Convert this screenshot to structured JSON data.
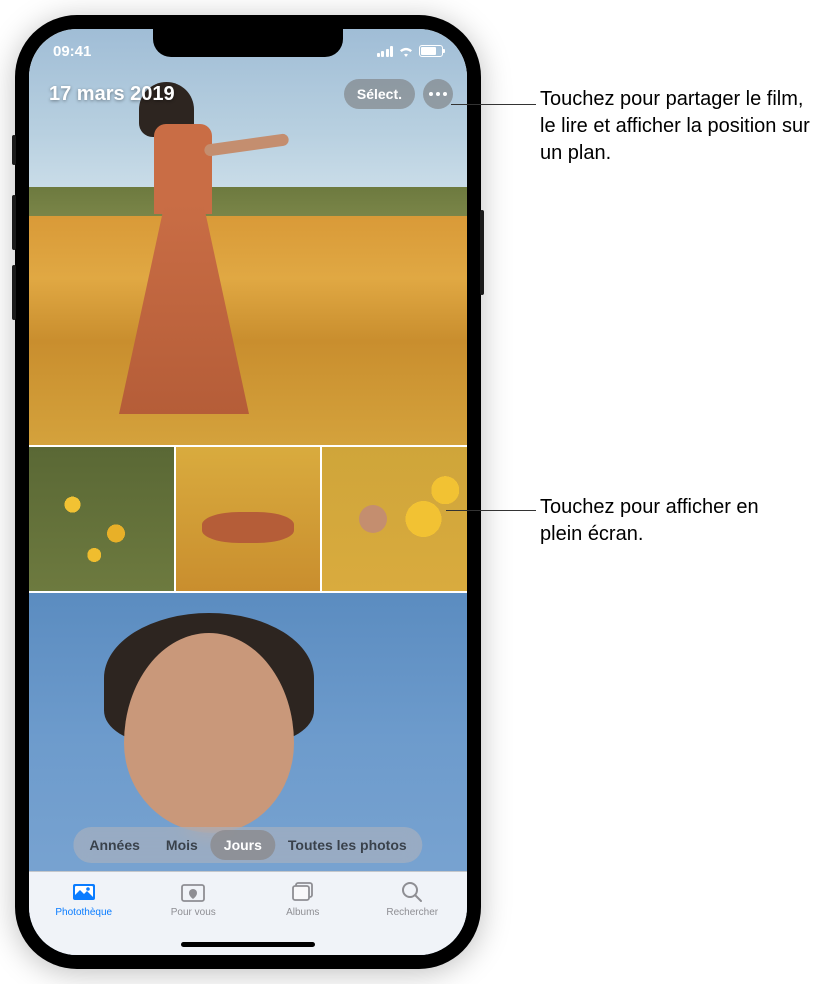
{
  "statusBar": {
    "time": "09:41"
  },
  "header": {
    "date": "17 mars 2019",
    "selectLabel": "Sélect."
  },
  "viewSegment": {
    "items": [
      "Années",
      "Mois",
      "Jours",
      "Toutes les photos"
    ],
    "activeIndex": 2
  },
  "tabs": {
    "items": [
      {
        "label": "Photothèque",
        "icon": "library"
      },
      {
        "label": "Pour vous",
        "icon": "foryou"
      },
      {
        "label": "Albums",
        "icon": "albums"
      },
      {
        "label": "Rechercher",
        "icon": "search"
      }
    ],
    "activeIndex": 0
  },
  "callouts": {
    "moreMenu": "Touchez pour partager le film, le lire et afficher la position sur un plan.",
    "fullscreen": "Touchez pour afficher en plein écran."
  }
}
